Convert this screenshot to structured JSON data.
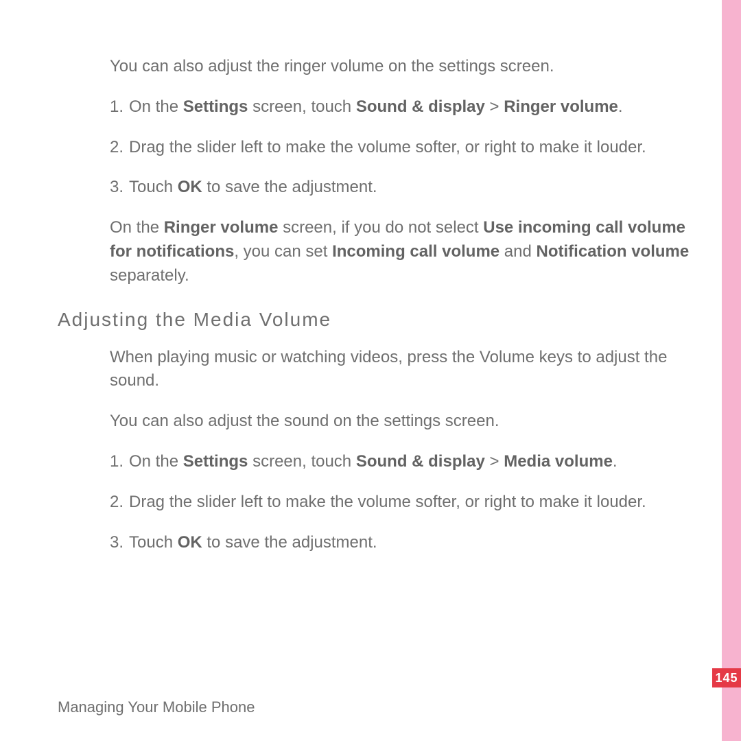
{
  "page_number": "145",
  "footer": "Managing Your Mobile Phone",
  "intro1": "You can also adjust the ringer volume on the settings screen.",
  "s1": {
    "n1": "1.",
    "t1a": "On the ",
    "t1b": "Settings",
    "t1c": " screen, touch ",
    "t1d": "Sound & display",
    "t1e": " > ",
    "t1f": "Ringer volume",
    "t1g": ".",
    "n2": "2.",
    "t2": "Drag the slider left to make the volume softer, or right to make it louder.",
    "n3": "3.",
    "t3a": "Touch ",
    "t3b": "OK",
    "t3c": " to save the adjustment."
  },
  "note": {
    "a": "On the ",
    "b": "Ringer volume",
    "c": " screen, if you do not select ",
    "d": "Use incoming call volume for notifications",
    "e": ", you can set ",
    "f": "Incoming call volume",
    "g": " and ",
    "h": "Notification volume",
    "i": " separately."
  },
  "heading2": "Adjusting the Media Volume",
  "intro2a": "When playing music or watching videos, press the Volume keys to adjust the sound.",
  "intro2b": "You can also adjust the sound on the settings screen.",
  "s2": {
    "n1": "1.",
    "t1a": "On the ",
    "t1b": "Settings",
    "t1c": " screen, touch ",
    "t1d": "Sound & display",
    "t1e": " > ",
    "t1f": "Media volume",
    "t1g": ".",
    "n2": "2.",
    "t2": "Drag the slider left to make the volume softer, or right to make it louder.",
    "n3": "3.",
    "t3a": "Touch ",
    "t3b": "OK",
    "t3c": " to save the adjustment."
  }
}
